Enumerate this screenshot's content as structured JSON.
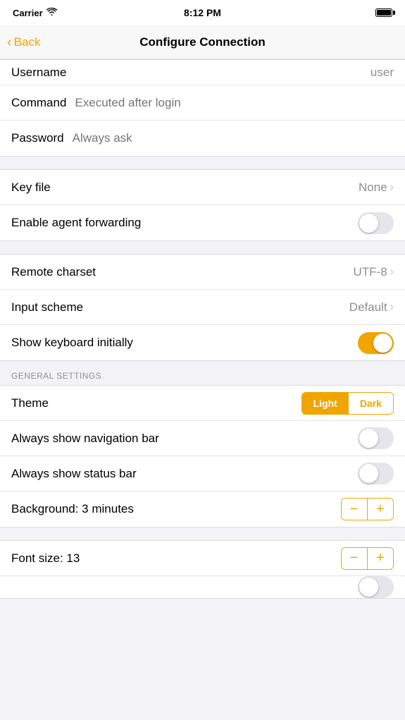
{
  "status": {
    "carrier": "Carrier",
    "time": "8:12 PM"
  },
  "nav": {
    "back_label": "Back",
    "title": "Configure Connection"
  },
  "rows": {
    "username_label": "Username",
    "username_value": "user",
    "command_label": "Command",
    "command_placeholder": "Executed after login",
    "password_label": "Password",
    "password_placeholder": "Always ask",
    "keyfile_label": "Key file",
    "keyfile_value": "None",
    "agent_forwarding_label": "Enable agent forwarding",
    "remote_charset_label": "Remote charset",
    "remote_charset_value": "UTF-8",
    "input_scheme_label": "Input scheme",
    "input_scheme_value": "Default",
    "show_keyboard_label": "Show keyboard initially",
    "general_section_header": "GENERAL SETTINGS",
    "theme_label": "Theme",
    "theme_options": [
      "Light",
      "Dark"
    ],
    "theme_selected": "Light",
    "always_nav_label": "Always show navigation bar",
    "always_status_label": "Always show status bar",
    "background_label": "Background: 3 minutes",
    "font_size_label": "Font size: 13",
    "stepper_minus": "−",
    "stepper_plus": "+"
  },
  "toggles": {
    "agent_forwarding": false,
    "show_keyboard": true,
    "always_nav": false,
    "always_status": false
  }
}
